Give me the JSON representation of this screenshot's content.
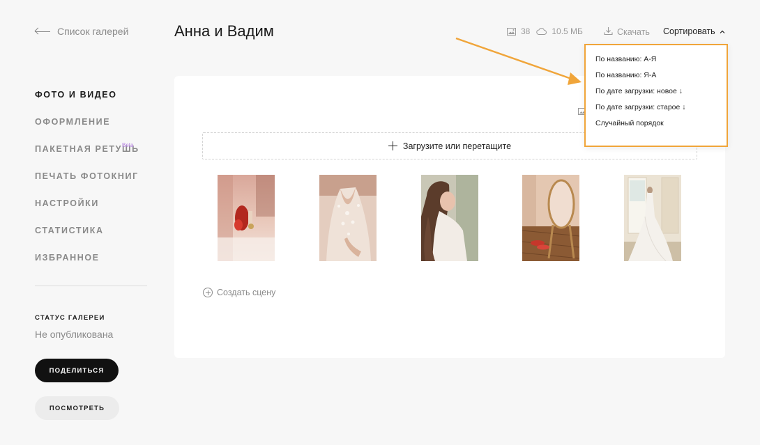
{
  "sidebar": {
    "back_label": "Список галерей",
    "nav": [
      {
        "label": "ФОТО И ВИДЕО"
      },
      {
        "label": "ОФОРМЛЕНИЕ"
      },
      {
        "label": "ПАКЕТНАЯ РЕТУШЬ",
        "badge": "Beta"
      },
      {
        "label": "ПЕЧАТЬ ФОТОКНИГ"
      },
      {
        "label": "НАСТРОЙКИ"
      },
      {
        "label": "СТАТИСТИКА"
      },
      {
        "label": "ИЗБРАННОЕ"
      }
    ],
    "active_index": 0,
    "status_label": "СТАТУС ГАЛЕРЕИ",
    "status_value": "Не опубликована",
    "share_button": "ПОДЕЛИТЬСЯ",
    "view_button": "ПОСМОТРЕТЬ"
  },
  "header": {
    "title": "Анна и Вадим",
    "photo_count": "38",
    "size": "10.5 МБ",
    "download_label": "Скачать",
    "sort_label": "Сортировать"
  },
  "main": {
    "upload_label": "Загрузите или перетащите",
    "create_scene_label": "Создать сцену",
    "photos": [
      {
        "name": "photo-shoes-table"
      },
      {
        "name": "photo-dress-back"
      },
      {
        "name": "photo-bride-portrait"
      },
      {
        "name": "photo-mirror-shoes"
      },
      {
        "name": "photo-bride-window"
      }
    ]
  },
  "sort_menu": {
    "items": [
      "По названию: А-Я",
      "По названию: Я-А",
      "По дате загрузки: новое ↓",
      "По дате загрузки: старое ↓",
      "Случайный порядок"
    ]
  },
  "colors": {
    "accent_annotation": "#f0a53a",
    "primary_button": "#111111",
    "beta_badge": "#b37fe0"
  },
  "icons": [
    "image-icon",
    "cloud-icon",
    "download-icon",
    "chevron-up-icon",
    "plus-icon",
    "circle-plus-icon",
    "arrow-left-icon"
  ]
}
